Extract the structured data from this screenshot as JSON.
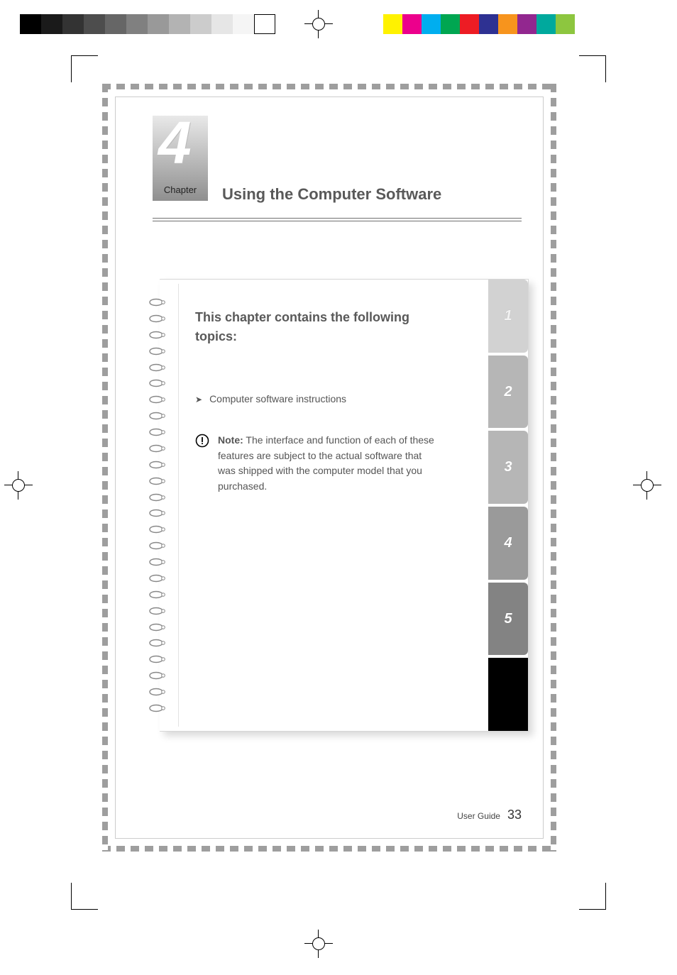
{
  "calibration": {
    "grayscale": [
      "#000000",
      "#1a1a1a",
      "#333333",
      "#4d4d4d",
      "#666666",
      "#808080",
      "#999999",
      "#b3b3b3",
      "#cccccc",
      "#e6e6e6",
      "#f5f5f5",
      "#ffffff"
    ],
    "colors": [
      "#fff200",
      "#ec008c",
      "#00aeef",
      "#00a651",
      "#ed1c24",
      "#2e3192",
      "#f7941d",
      "#92278f",
      "#00a99d",
      "#8dc63f"
    ]
  },
  "chapter": {
    "number": "4",
    "label": "Chapter",
    "title": "Using the Computer Software"
  },
  "notebook": {
    "heading": "This chapter contains the following topics:",
    "bullet_glyph": "➤",
    "bullets": [
      "Computer software instructions"
    ],
    "note": {
      "label": "Note:",
      "text": "The interface and function of each of these features are subject to the actual software that was shipped with the computer model that you purchased."
    },
    "tabs": [
      "1",
      "2",
      "3",
      "4",
      "5",
      ""
    ]
  },
  "footer": {
    "label": "User Guide",
    "page": "33"
  }
}
